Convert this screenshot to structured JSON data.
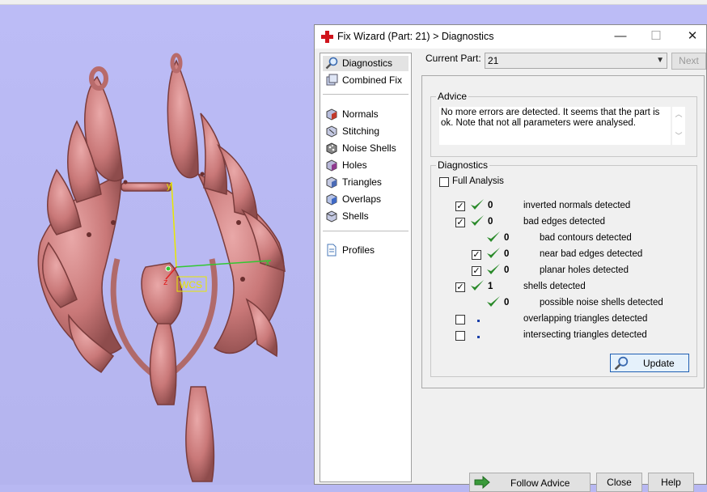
{
  "dialog": {
    "title": "Fix Wizard (Part: 21) > Diagnostics",
    "minimize": "—",
    "maximize": "☐",
    "close": "✕"
  },
  "viewport": {
    "axis_y": "y",
    "axis_z": "z",
    "axis_x": "x",
    "origin_label": "WCS"
  },
  "nav": {
    "items": [
      {
        "label": "Diagnostics",
        "icon": "magnifier-icon"
      },
      {
        "label": "Combined Fix",
        "icon": "cube-stack-icon"
      },
      {
        "label": "Normals",
        "icon": "normals-cube-icon"
      },
      {
        "label": "Stitching",
        "icon": "stitching-cube-icon"
      },
      {
        "label": "Noise Shells",
        "icon": "noise-cube-icon"
      },
      {
        "label": "Holes",
        "icon": "holes-cube-icon"
      },
      {
        "label": "Triangles",
        "icon": "triangles-cube-icon"
      },
      {
        "label": "Overlaps",
        "icon": "overlaps-cube-icon"
      },
      {
        "label": "Shells",
        "icon": "shells-cube-icon"
      },
      {
        "label": "Profiles",
        "icon": "document-icon"
      }
    ]
  },
  "current_part": {
    "label": "Current Part:",
    "value": "21",
    "next": "Next"
  },
  "advice": {
    "title": "Advice",
    "text": "No more errors are detected. It seems that the part is ok. Note that not all parameters were analysed."
  },
  "diagnostics": {
    "title": "Diagnostics",
    "full_analysis": "Full Analysis",
    "rows": [
      {
        "count": "0",
        "label": "inverted normals detected"
      },
      {
        "count": "0",
        "label": "bad edges detected"
      },
      {
        "count": "0",
        "label": "bad contours detected"
      },
      {
        "count": "0",
        "label": "near bad edges detected"
      },
      {
        "count": "0",
        "label": "planar holes detected"
      },
      {
        "count": "1",
        "label": "shells detected"
      },
      {
        "count": "0",
        "label": "possible noise shells detected"
      },
      {
        "count": "",
        "label": "overlapping triangles detected"
      },
      {
        "count": "",
        "label": "intersecting triangles detected"
      }
    ],
    "check_mark": "✓",
    "update": "Update"
  },
  "footer": {
    "follow_advice": "Follow Advice",
    "close": "Close",
    "help": "Help"
  },
  "colors": {
    "tick": "#2a8a2a",
    "model": "#c97a7a",
    "viewport": "#b8b8f2"
  }
}
